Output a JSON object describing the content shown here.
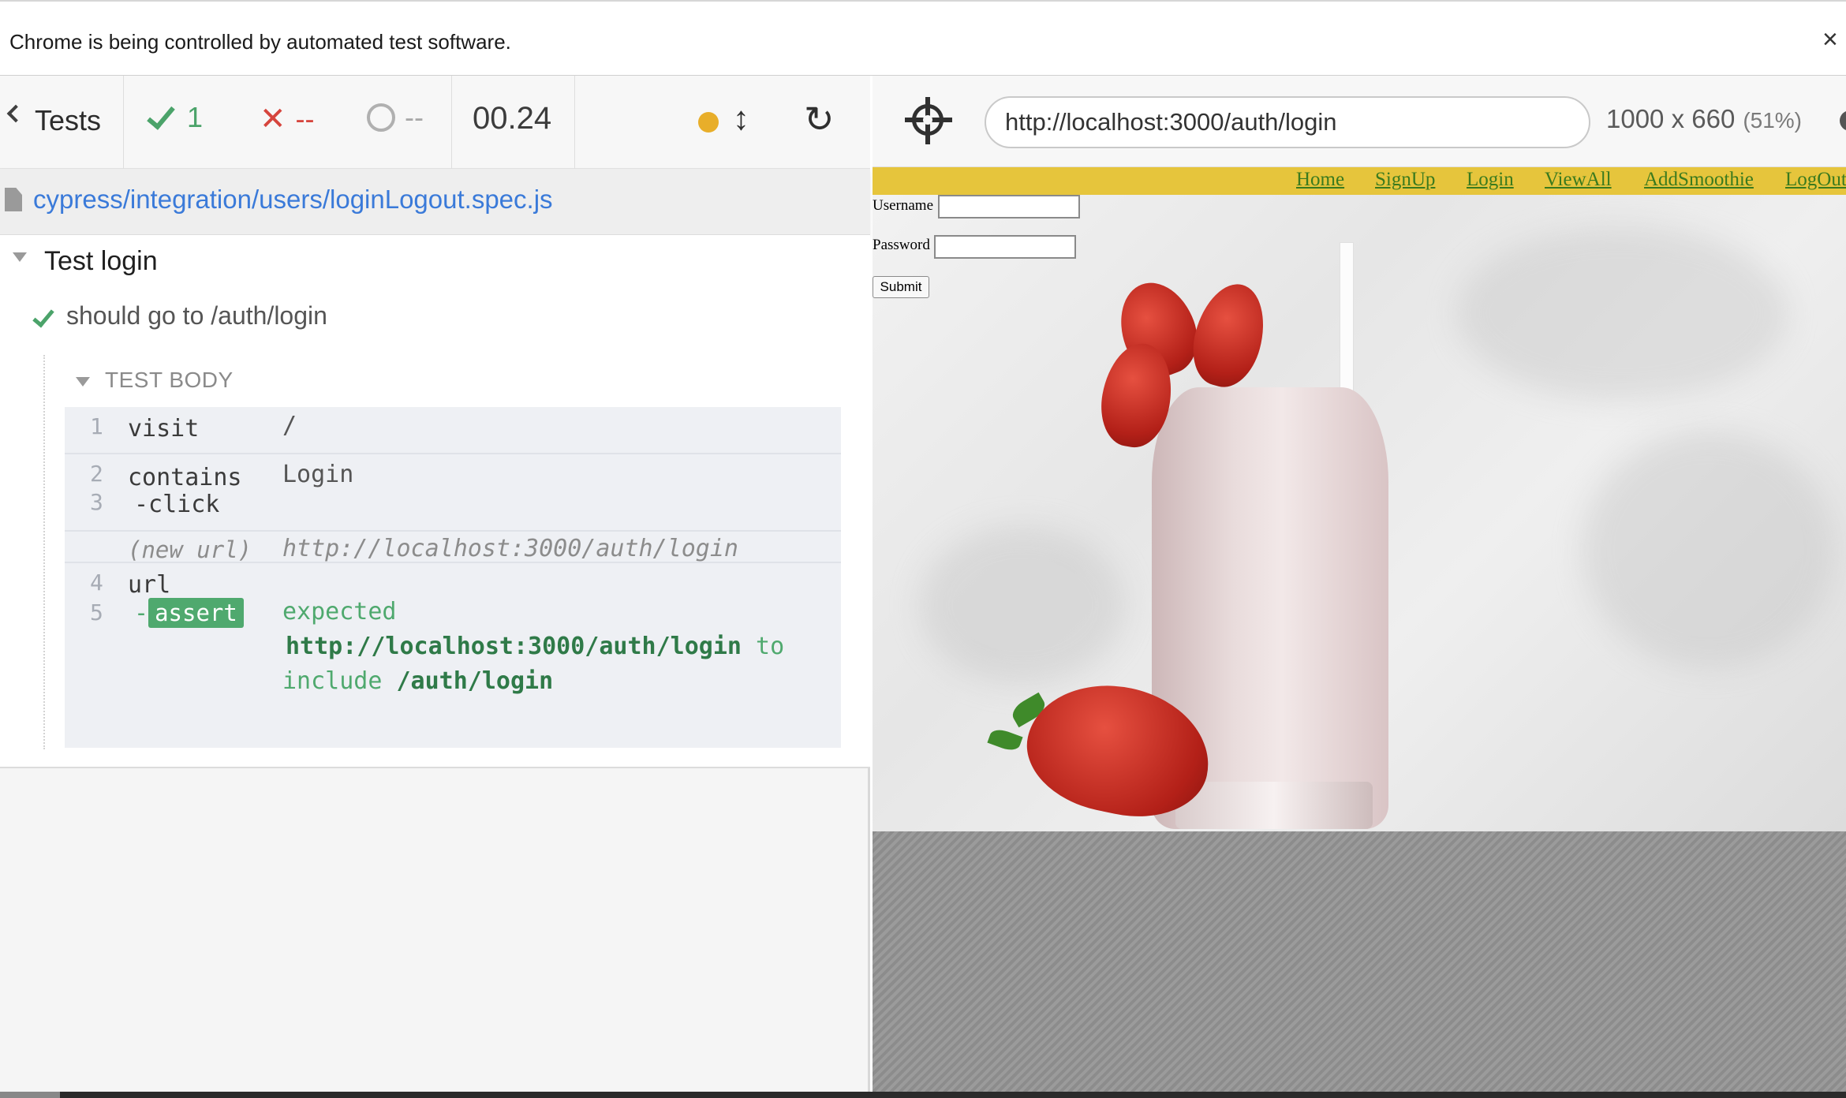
{
  "infobar": {
    "message": "Chrome is being controlled by automated test software.",
    "close_glyph": "×"
  },
  "reporter": {
    "tests_label": "Tests",
    "stats": {
      "passed": "1",
      "failed": "--",
      "pending": "--"
    },
    "duration": "00.24",
    "running_indicator_color": "#e8ae2a",
    "icons": [
      "chevron-left-icon",
      "check-icon",
      "x-icon",
      "pending-circle-icon",
      "scroll-arrows-icon",
      "reload-icon",
      "file-icon"
    ],
    "spec_path": "cypress/integration/users/loginLogout.spec.js",
    "suite_title": "Test login",
    "test_title": "should go to /auth/login",
    "test_body_label": "TEST BODY",
    "commands": [
      {
        "num": "1",
        "name": "visit",
        "message": "/"
      },
      {
        "num": "2",
        "name": "contains",
        "message": "Login"
      },
      {
        "num": "3",
        "name": "-click",
        "message": ""
      },
      {
        "num": "",
        "name": "(new url)",
        "message": "http://localhost:3000/auth/login"
      },
      {
        "num": "4",
        "name": "url",
        "message": ""
      },
      {
        "num": "5",
        "name": "-",
        "badge": "assert",
        "message_parts": [
          "expected",
          "http://localhost:3000/auth/login",
          "to",
          "include",
          "/auth/login"
        ]
      }
    ]
  },
  "aut": {
    "url": "http://localhost:3000/auth/login",
    "viewport": "1000 x 660",
    "scale": "(51%)",
    "nav_links": [
      "Home",
      "SignUp",
      "Login",
      "ViewAll",
      "AddSmoothie",
      "LogOut"
    ],
    "form": {
      "username_label": "Username",
      "password_label": "Password",
      "submit_label": "Submit"
    },
    "colors": {
      "navbar": "#e6c53c",
      "link": "#3a7a1e",
      "passed": "#4ba36a",
      "failed": "#d6453d",
      "spec_link": "#3a7ad9"
    }
  }
}
